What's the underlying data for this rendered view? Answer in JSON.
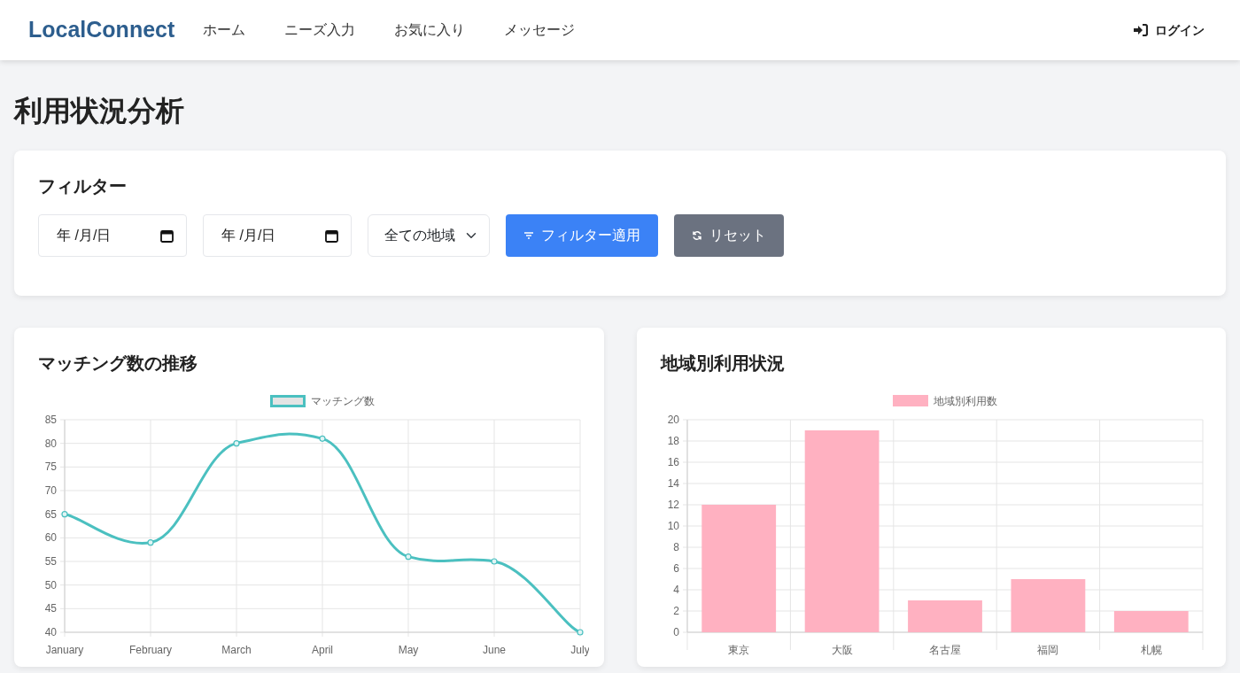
{
  "navbar": {
    "brand": "LocalConnect",
    "links": [
      {
        "label": "ホーム"
      },
      {
        "label": "ニーズ入力"
      },
      {
        "label": "お気に入り"
      },
      {
        "label": "メッセージ"
      }
    ],
    "login": "ログイン"
  },
  "page_title": "利用状況分析",
  "filter": {
    "title": "フィルター",
    "date_from": {
      "placeholder": "年 /月/日"
    },
    "date_to": {
      "placeholder": "年 /月/日"
    },
    "region": {
      "value": "全ての地域"
    },
    "apply_button": "フィルター適用",
    "reset_button": "リセット"
  },
  "charts": [
    {
      "title": "マッチング数の推移",
      "chart_data": {
        "type": "line",
        "categories": [
          "January",
          "February",
          "March",
          "April",
          "May",
          "June",
          "July"
        ],
        "series": [
          {
            "name": "マッチング数",
            "color": "#4bc0c0",
            "marker": "circle",
            "values": [
              65,
              59,
              80,
              81,
              56,
              55,
              40
            ]
          }
        ],
        "grid": true,
        "ylim": [
          40,
          85
        ],
        "yticks": [
          40,
          45,
          50,
          55,
          60,
          65,
          70,
          75,
          80,
          85
        ]
      }
    },
    {
      "title": "地域別利用状況",
      "chart_data": {
        "type": "bar",
        "categories": [
          "東京",
          "大阪",
          "名古屋",
          "福岡",
          "札幌"
        ],
        "series": [
          {
            "name": "地域別利用数",
            "color": "#ffb1c1",
            "values": [
              12,
              19,
              3,
              5,
              2
            ]
          }
        ],
        "grid": true,
        "ylim": [
          0,
          20
        ],
        "yticks": [
          0,
          2,
          4,
          6,
          8,
          10,
          12,
          14,
          16,
          18,
          20
        ]
      }
    }
  ]
}
